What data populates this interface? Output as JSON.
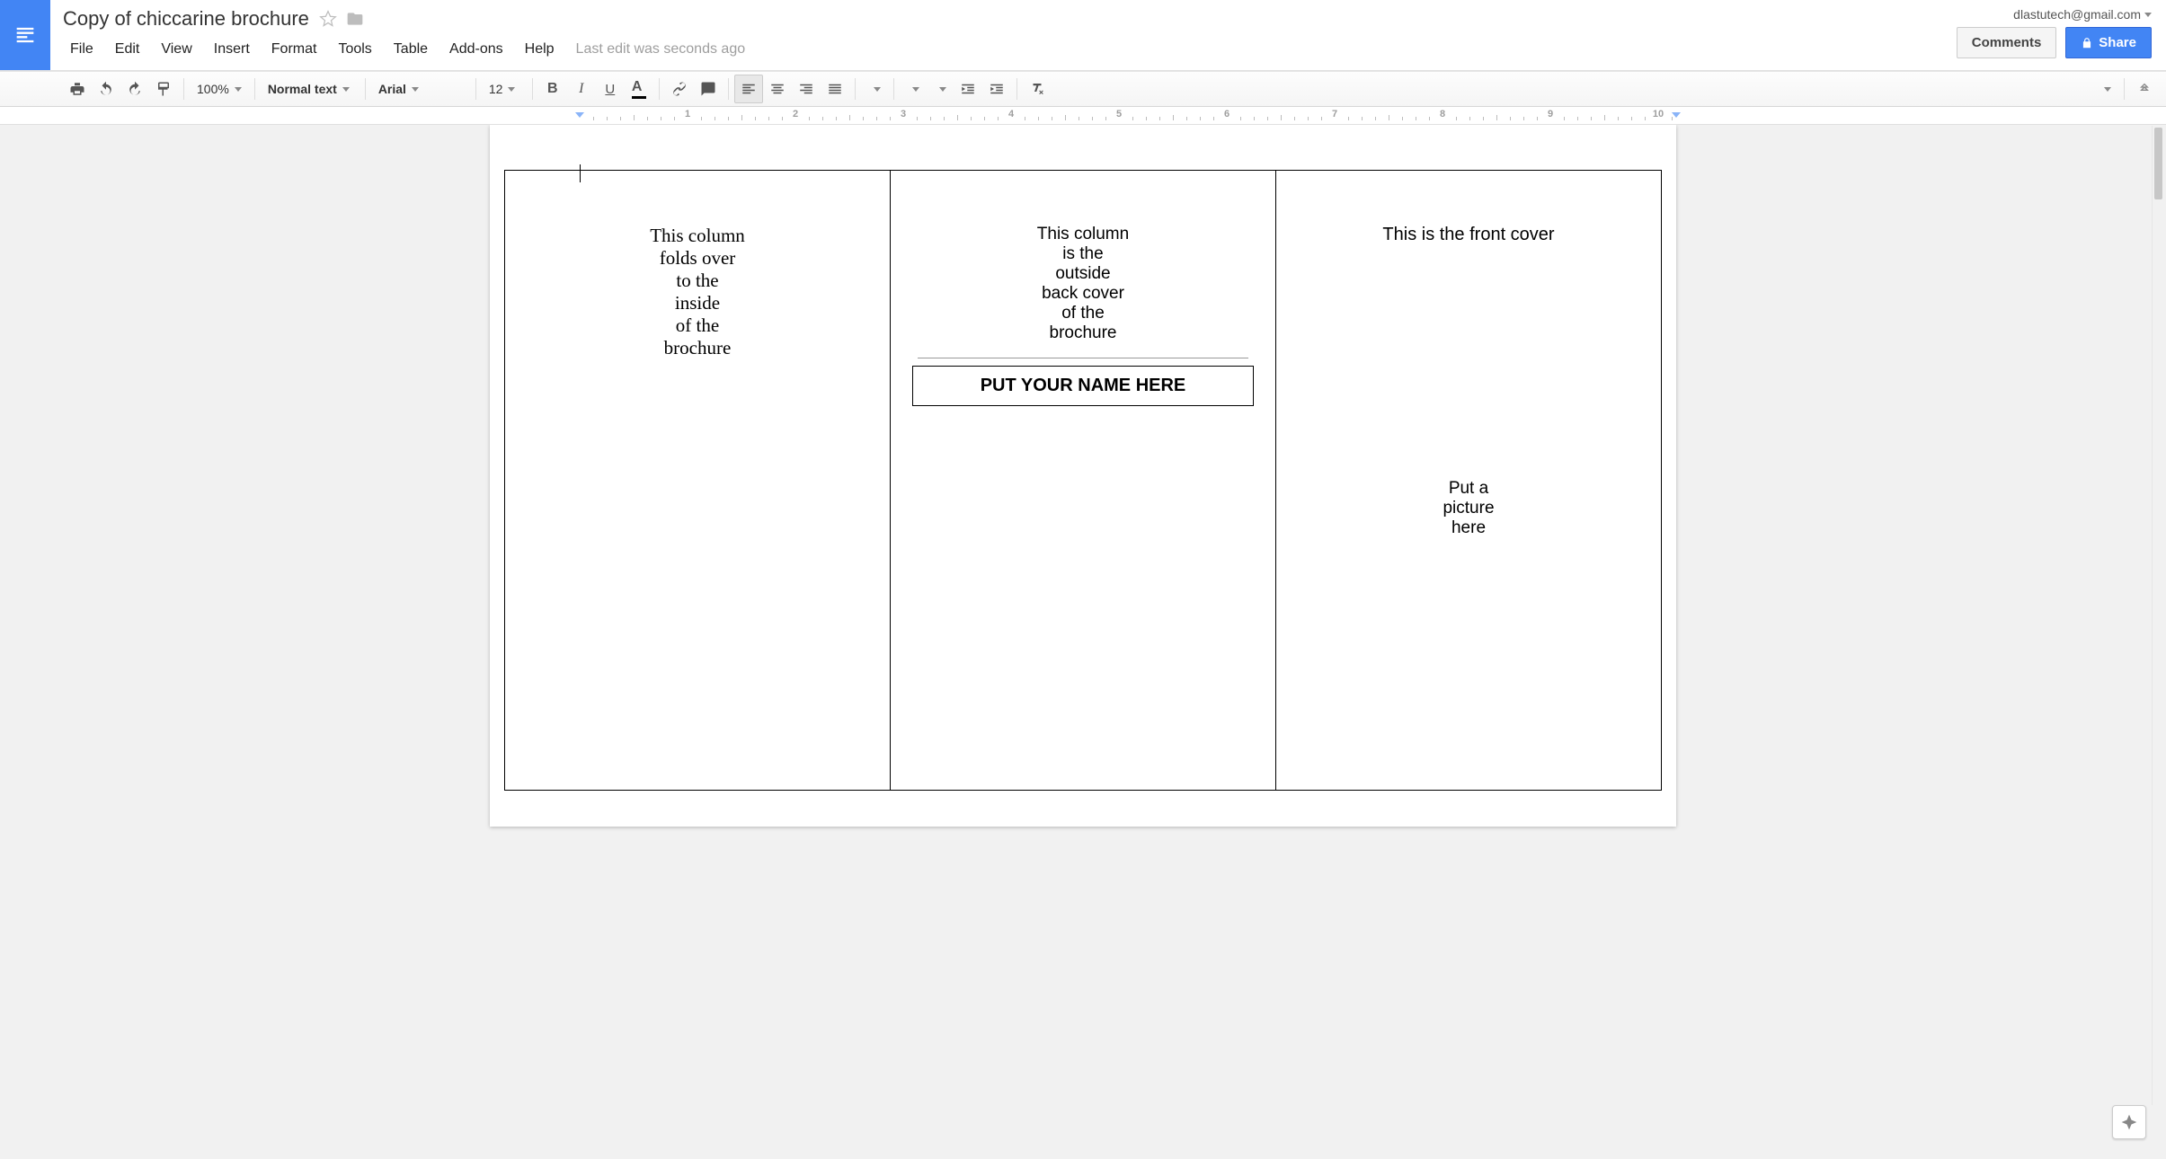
{
  "header": {
    "title": "Copy of chiccarine brochure",
    "user_email": "dlastutech@gmail.com",
    "comments_label": "Comments",
    "share_label": "Share"
  },
  "menus": {
    "file": "File",
    "edit": "Edit",
    "view": "View",
    "insert": "Insert",
    "format": "Format",
    "tools": "Tools",
    "table": "Table",
    "addons": "Add-ons",
    "help": "Help",
    "last_edit": "Last edit was seconds ago"
  },
  "toolbar": {
    "zoom": "100%",
    "style": "Normal text",
    "font": "Arial",
    "font_size": "12"
  },
  "ruler": {
    "numbers": [
      "1",
      "2",
      "3",
      "4",
      "5",
      "6",
      "7",
      "8",
      "9",
      "10"
    ]
  },
  "doc": {
    "col1_lines": [
      "This column",
      "folds over",
      "to the",
      "inside",
      "of the",
      "brochure"
    ],
    "col2_lines": [
      "This column",
      "is the",
      "outside",
      "back cover",
      "of the",
      "brochure"
    ],
    "col2_name_box": "PUT YOUR NAME HERE",
    "col3_title": "This is the front cover",
    "col3_pic_lines": [
      "Put a",
      "picture",
      "here"
    ]
  }
}
